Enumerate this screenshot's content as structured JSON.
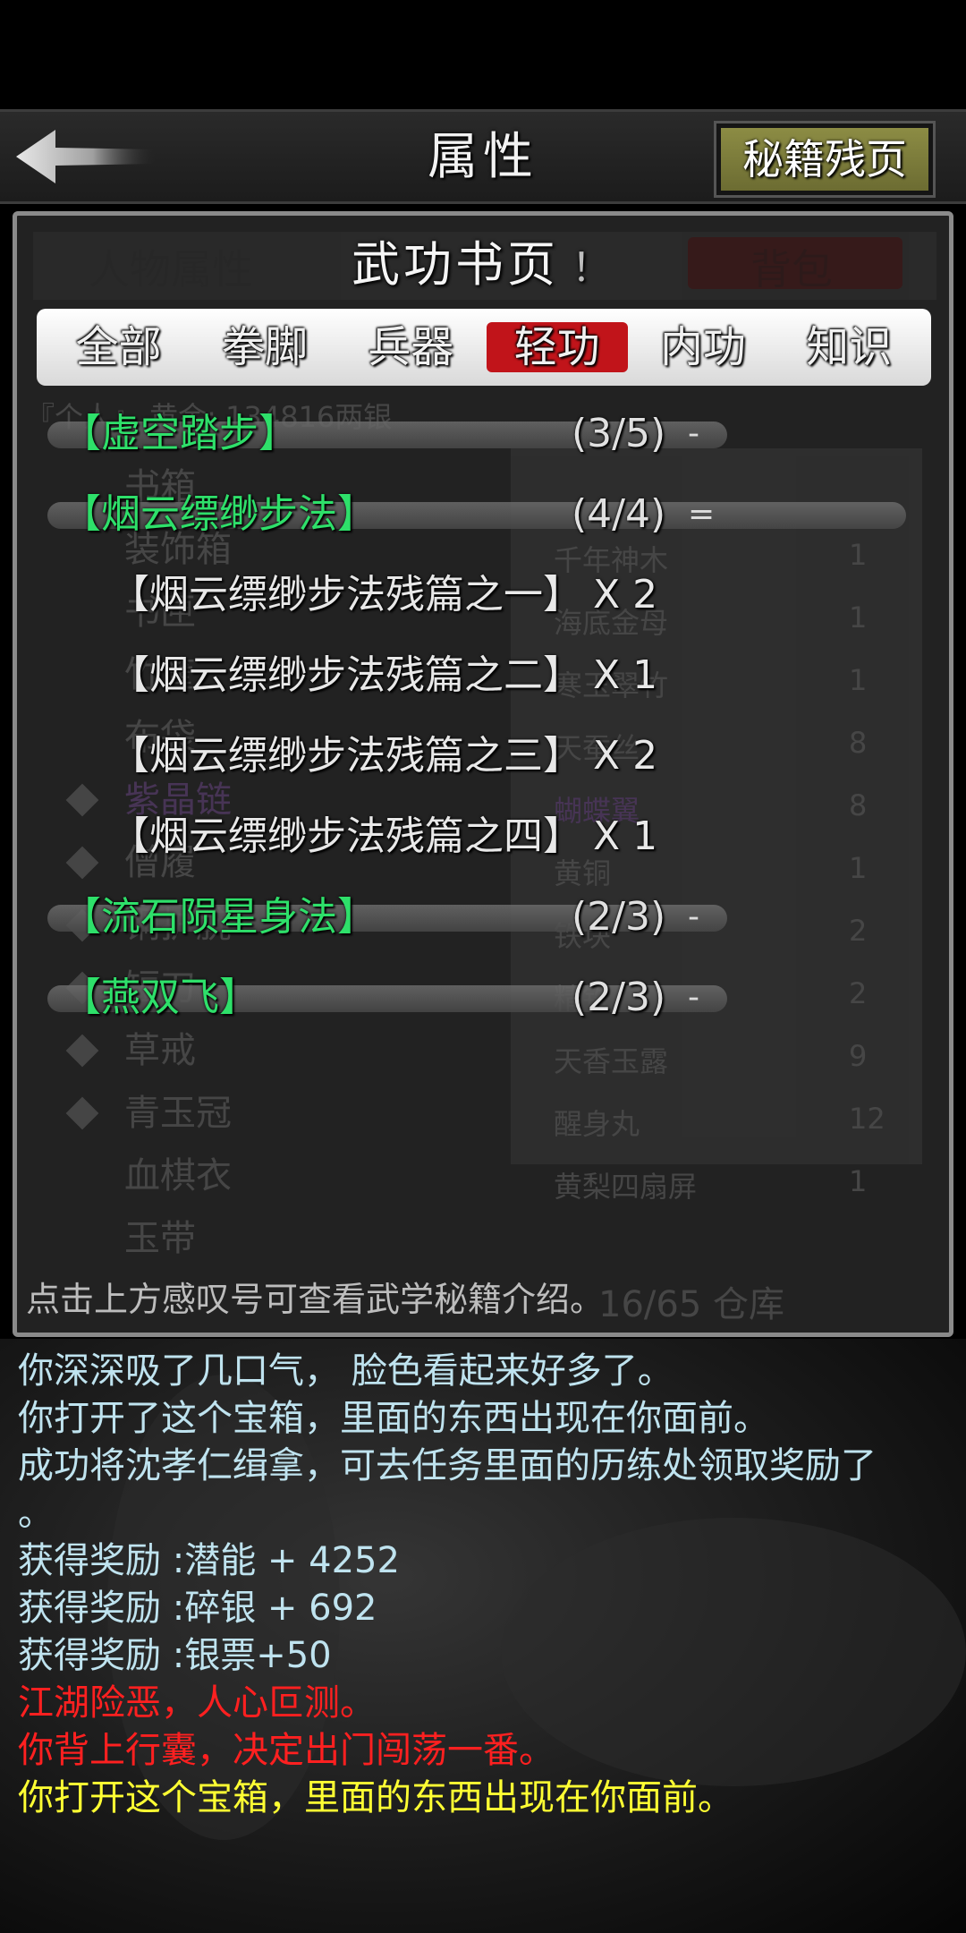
{
  "header": {
    "title": "属性",
    "fragments_button": "秘籍残页"
  },
  "panel": {
    "book_title": "武功书页",
    "info_icon": "！",
    "background": {
      "tab_left": "人物属性",
      "tab_right": "背包",
      "left_items": [
        "书箱",
        "装饰箱",
        "书匣",
        "竹筐",
        "布袋",
        "紫晶链",
        "僧履",
        "铜护腕",
        "短刀",
        "草戒",
        "青玉冠",
        "血棋衣",
        "玉带"
      ],
      "right_items": [
        {
          "name": "千年神木",
          "count": "1"
        },
        {
          "name": "海底金母",
          "count": "1"
        },
        {
          "name": "寒玉翠竹",
          "count": "1"
        },
        {
          "name": "天蚕丝",
          "count": "8"
        },
        {
          "name": "蝴蝶翼",
          "count": "8"
        },
        {
          "name": "黄铜",
          "count": "1"
        },
        {
          "name": "铁块",
          "count": "2"
        },
        {
          "name": "精铁",
          "count": "2"
        },
        {
          "name": "天香玉露",
          "count": "9"
        },
        {
          "name": "醒身丸",
          "count": "12"
        },
        {
          "name": "黄梨四扇屏",
          "count": "1"
        }
      ],
      "gold_text": "『个人』 黄金: 134816两银",
      "capacity": "16/65 仓库"
    },
    "tabs": [
      {
        "label": "全部",
        "active": false
      },
      {
        "label": "拳脚",
        "active": false
      },
      {
        "label": "兵器",
        "active": false
      },
      {
        "label": "轻功",
        "active": true
      },
      {
        "label": "内功",
        "active": false
      },
      {
        "label": "知识",
        "active": false
      }
    ],
    "skills": {
      "s1": {
        "name": "【虚空踏步】",
        "progress": "(3/5)",
        "toggle": "-"
      },
      "s2": {
        "name": "【烟云缥缈步法】",
        "progress": "(4/4)",
        "toggle": "="
      },
      "s3": {
        "name": "【流石陨星身法】",
        "progress": "(2/3)",
        "toggle": "-"
      },
      "s4": {
        "name": "【燕双飞】",
        "progress": "(2/3)",
        "toggle": "-"
      }
    },
    "pages": [
      {
        "name": "【烟云缥缈步法残篇之一】",
        "count": "X 2"
      },
      {
        "name": "【烟云缥缈步法残篇之二】",
        "count": "X 1"
      },
      {
        "name": "【烟云缥缈步法残篇之三】",
        "count": "X 2"
      },
      {
        "name": "【烟云缥缈步法残篇之四】",
        "count": "X 1"
      }
    ],
    "hint": "点击上方感叹号可查看武学秘籍介绍。"
  },
  "log": {
    "lines": [
      {
        "text": "你深深吸了几口气， 脸色看起来好多了。",
        "color": "#bfe3ef"
      },
      {
        "text": "你打开了这个宝箱，里面的东西出现在你面前。",
        "color": "#bfe3ef"
      },
      {
        "text": "成功将沈孝仁缉拿，可去任务里面的历练处领取奖励了",
        "color": "#bfe3ef"
      },
      {
        "text": "。",
        "color": "#bfe3ef"
      },
      {
        "text": "获得奖励 :潜能 + 4252",
        "color": "#bfe3ef"
      },
      {
        "text": "获得奖励 :碎银 + 692",
        "color": "#bfe3ef"
      },
      {
        "text": "获得奖励 :银票+50",
        "color": "#bfe3ef"
      },
      {
        "text": "江湖险恶，人心叵测。",
        "color": "#ff2020"
      },
      {
        "text": "你背上行囊，决定出门闯荡一番。",
        "color": "#ff2020"
      },
      {
        "text": "你打开这个宝箱，里面的东西出现在你面前。",
        "color": "#ffff33"
      }
    ]
  },
  "icons": {
    "back": "back-arrow-icon",
    "info": "exclamation-icon"
  }
}
